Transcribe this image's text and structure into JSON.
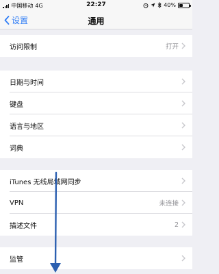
{
  "status_bar": {
    "carrier": "中国移动",
    "network": "4G",
    "time": "22:27",
    "battery_percent": "40%",
    "battery_level": 0.4
  },
  "nav": {
    "back_label": "设置",
    "title": "通用"
  },
  "rows": {
    "restrictions": {
      "label": "访问限制",
      "value": "打开"
    },
    "date_time": {
      "label": "日期与时间"
    },
    "keyboard": {
      "label": "键盘"
    },
    "language_region": {
      "label": "语言与地区"
    },
    "dictionary": {
      "label": "词典"
    },
    "itunes_sync": {
      "label": "iTunes 无线局域网同步"
    },
    "vpn": {
      "label": "VPN",
      "value": "未连接"
    },
    "profiles": {
      "label": "描述文件",
      "value": "2"
    },
    "supervision": {
      "label": "监管"
    }
  },
  "annotation": {
    "arrow_color": "#2b5fb0"
  }
}
